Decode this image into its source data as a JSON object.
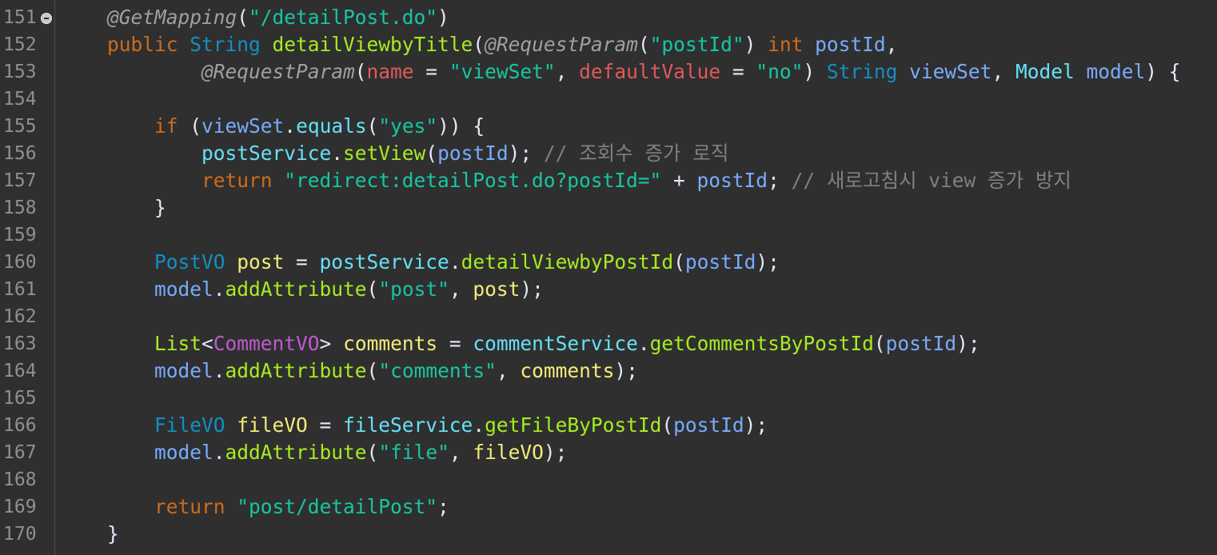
{
  "editor": {
    "line_numbers": [
      "151",
      "152",
      "153",
      "154",
      "155",
      "156",
      "157",
      "158",
      "159",
      "160",
      "161",
      "162",
      "163",
      "164",
      "165",
      "166",
      "167",
      "168",
      "169",
      "170"
    ],
    "fold_icon": "minus-circle-icon",
    "colors": {
      "background": "#2f2f2f",
      "keyword": "#cc6c1d",
      "annotation": "#a0a0a0",
      "type": "#1290c3",
      "method": "#a7ec21",
      "parameter": "#79abff",
      "local_variable": "#f3ec79",
      "string": "#17c6a3",
      "field": "#66e1f8",
      "generic": "#bf5ad1",
      "annotation_attr": "#e05a5a",
      "comment": "#808080"
    },
    "lines": [
      [
        {
          "c": "ann",
          "t": "    @GetMapping"
        },
        {
          "c": "pun",
          "t": "("
        },
        {
          "c": "str",
          "t": "\"/detailPost.do\""
        },
        {
          "c": "pun",
          "t": ")"
        }
      ],
      [
        {
          "c": "kw",
          "t": "    public "
        },
        {
          "c": "type",
          "t": "String "
        },
        {
          "c": "meth",
          "t": "detailViewbyTitle"
        },
        {
          "c": "pun",
          "t": "("
        },
        {
          "c": "ann",
          "t": "@RequestParam"
        },
        {
          "c": "pun",
          "t": "("
        },
        {
          "c": "str",
          "t": "\"postId\""
        },
        {
          "c": "pun",
          "t": ") "
        },
        {
          "c": "kw",
          "t": "int "
        },
        {
          "c": "param",
          "t": "postId"
        },
        {
          "c": "pun",
          "t": ","
        }
      ],
      [
        {
          "c": "ann",
          "t": "            @RequestParam"
        },
        {
          "c": "pun",
          "t": "("
        },
        {
          "c": "red",
          "t": "name"
        },
        {
          "c": "pun",
          "t": " = "
        },
        {
          "c": "str",
          "t": "\"viewSet\""
        },
        {
          "c": "pun",
          "t": ", "
        },
        {
          "c": "red",
          "t": "defaultValue"
        },
        {
          "c": "pun",
          "t": " = "
        },
        {
          "c": "str",
          "t": "\"no\""
        },
        {
          "c": "pun",
          "t": ") "
        },
        {
          "c": "type",
          "t": "String "
        },
        {
          "c": "param",
          "t": "viewSet"
        },
        {
          "c": "pun",
          "t": ", "
        },
        {
          "c": "field",
          "t": "Model "
        },
        {
          "c": "param",
          "t": "model"
        },
        {
          "c": "pun",
          "t": ") {"
        }
      ],
      [],
      [
        {
          "c": "kw",
          "t": "        if "
        },
        {
          "c": "pun",
          "t": "("
        },
        {
          "c": "param",
          "t": "viewSet"
        },
        {
          "c": "pun",
          "t": "."
        },
        {
          "c": "field",
          "t": "equals"
        },
        {
          "c": "pun",
          "t": "("
        },
        {
          "c": "str",
          "t": "\"yes\""
        },
        {
          "c": "pun",
          "t": ")) {"
        }
      ],
      [
        {
          "c": "field",
          "t": "            postService"
        },
        {
          "c": "pun",
          "t": "."
        },
        {
          "c": "meth",
          "t": "setView"
        },
        {
          "c": "pun",
          "t": "("
        },
        {
          "c": "param",
          "t": "postId"
        },
        {
          "c": "pun",
          "t": "); "
        },
        {
          "c": "cmt",
          "t": "// 조회수 증가 로직"
        }
      ],
      [
        {
          "c": "kw",
          "t": "            return "
        },
        {
          "c": "str",
          "t": "\"redirect:detailPost.do?postId=\""
        },
        {
          "c": "pun",
          "t": " + "
        },
        {
          "c": "param",
          "t": "postId"
        },
        {
          "c": "pun",
          "t": "; "
        },
        {
          "c": "cmt",
          "t": "// 새로고침시 view 증가 방지"
        }
      ],
      [
        {
          "c": "pun",
          "t": "        }"
        }
      ],
      [],
      [
        {
          "c": "type",
          "t": "        PostVO "
        },
        {
          "c": "var",
          "t": "post"
        },
        {
          "c": "pun",
          "t": " = "
        },
        {
          "c": "field",
          "t": "postService"
        },
        {
          "c": "pun",
          "t": "."
        },
        {
          "c": "meth",
          "t": "detailViewbyPostId"
        },
        {
          "c": "pun",
          "t": "("
        },
        {
          "c": "param",
          "t": "postId"
        },
        {
          "c": "pun",
          "t": ");"
        }
      ],
      [
        {
          "c": "param",
          "t": "        model"
        },
        {
          "c": "pun",
          "t": "."
        },
        {
          "c": "meth",
          "t": "addAttribute"
        },
        {
          "c": "pun",
          "t": "("
        },
        {
          "c": "str",
          "t": "\"post\""
        },
        {
          "c": "pun",
          "t": ", "
        },
        {
          "c": "var",
          "t": "post"
        },
        {
          "c": "pun",
          "t": ");"
        }
      ],
      [],
      [
        {
          "c": "meth",
          "t": "        List"
        },
        {
          "c": "pun",
          "t": "<"
        },
        {
          "c": "gen",
          "t": "CommentVO"
        },
        {
          "c": "pun",
          "t": "> "
        },
        {
          "c": "var",
          "t": "comments"
        },
        {
          "c": "pun",
          "t": " = "
        },
        {
          "c": "field",
          "t": "commentService"
        },
        {
          "c": "pun",
          "t": "."
        },
        {
          "c": "meth",
          "t": "getCommentsByPostId"
        },
        {
          "c": "pun",
          "t": "("
        },
        {
          "c": "param",
          "t": "postId"
        },
        {
          "c": "pun",
          "t": ");"
        }
      ],
      [
        {
          "c": "param",
          "t": "        model"
        },
        {
          "c": "pun",
          "t": "."
        },
        {
          "c": "meth",
          "t": "addAttribute"
        },
        {
          "c": "pun",
          "t": "("
        },
        {
          "c": "str",
          "t": "\"comments\""
        },
        {
          "c": "pun",
          "t": ", "
        },
        {
          "c": "var",
          "t": "comments"
        },
        {
          "c": "pun",
          "t": ");"
        }
      ],
      [],
      [
        {
          "c": "type",
          "t": "        FileVO "
        },
        {
          "c": "var",
          "t": "fileVO"
        },
        {
          "c": "pun",
          "t": " = "
        },
        {
          "c": "field",
          "t": "fileService"
        },
        {
          "c": "pun",
          "t": "."
        },
        {
          "c": "meth",
          "t": "getFileByPostId"
        },
        {
          "c": "pun",
          "t": "("
        },
        {
          "c": "param",
          "t": "postId"
        },
        {
          "c": "pun",
          "t": ");"
        }
      ],
      [
        {
          "c": "param",
          "t": "        model"
        },
        {
          "c": "pun",
          "t": "."
        },
        {
          "c": "meth",
          "t": "addAttribute"
        },
        {
          "c": "pun",
          "t": "("
        },
        {
          "c": "str",
          "t": "\"file\""
        },
        {
          "c": "pun",
          "t": ", "
        },
        {
          "c": "var",
          "t": "fileVO"
        },
        {
          "c": "pun",
          "t": ");"
        }
      ],
      [],
      [
        {
          "c": "kw",
          "t": "        return "
        },
        {
          "c": "str",
          "t": "\"post/detailPost\""
        },
        {
          "c": "pun",
          "t": ";"
        }
      ],
      [
        {
          "c": "pun",
          "t": "    }"
        }
      ]
    ]
  }
}
